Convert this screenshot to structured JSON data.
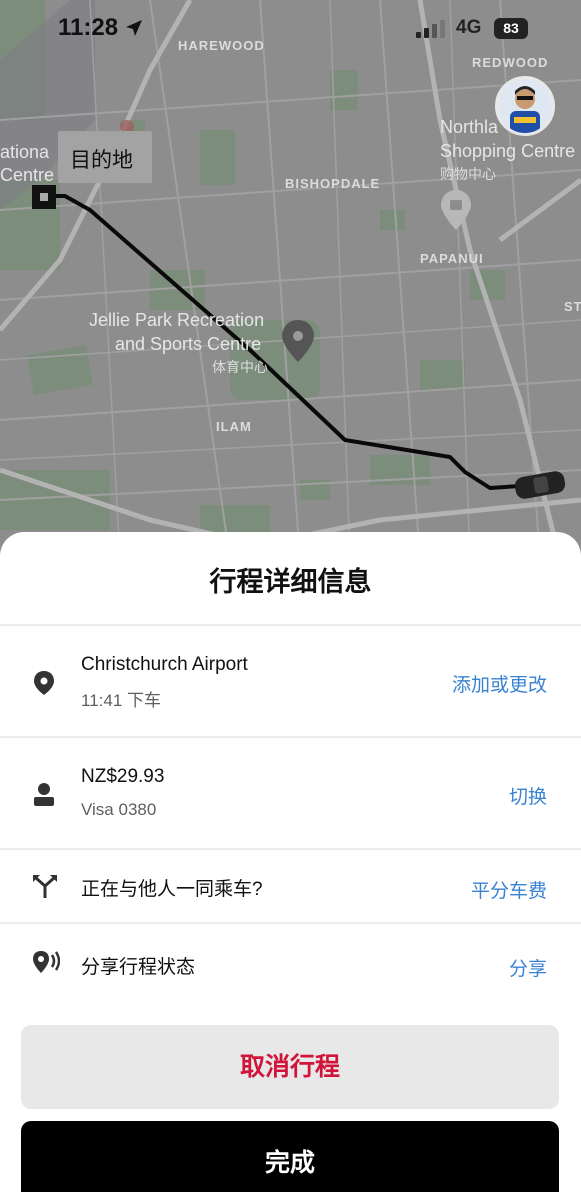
{
  "status_bar": {
    "time": "11:28",
    "network": "4G",
    "battery": "83"
  },
  "map": {
    "suburbs": [
      "HAREWOOD",
      "REDWOOD",
      "BISHOPDALE",
      "PAPANUI",
      "ILAM",
      "ST"
    ],
    "poi_left_line1": "ationa",
    "poi_left_line2": "Centre",
    "poi_northlands_line1": "Northla",
    "poi_northlands_line2": "Shopping Centre",
    "poi_northlands_sub": "购物中心",
    "poi_jellie_line1": "Jellie Park Recreation",
    "poi_jellie_line2": "and Sports Centre",
    "poi_jellie_sub": "体育中心",
    "destination_label": "目的地"
  },
  "sheet": {
    "title": "行程详细信息",
    "destination": {
      "name": "Christchurch Airport",
      "dropoff": "11:41 下车",
      "action": "添加或更改",
      "icon": "location-pin-icon"
    },
    "payment": {
      "amount": "NZ$29.93",
      "card": "Visa 0380",
      "action": "切换",
      "icon": "person-icon"
    },
    "split": {
      "label": "正在与他人一同乘车?",
      "action": "平分车费",
      "icon": "split-fork-icon"
    },
    "share": {
      "label": "分享行程状态",
      "action": "分享",
      "icon": "share-location-icon"
    },
    "cancel_label": "取消行程",
    "done_label": "完成"
  },
  "colors": {
    "accent_blue": "#3a82d2",
    "cancel_red": "#d0143a",
    "map_bg": "#8d8d8d"
  }
}
